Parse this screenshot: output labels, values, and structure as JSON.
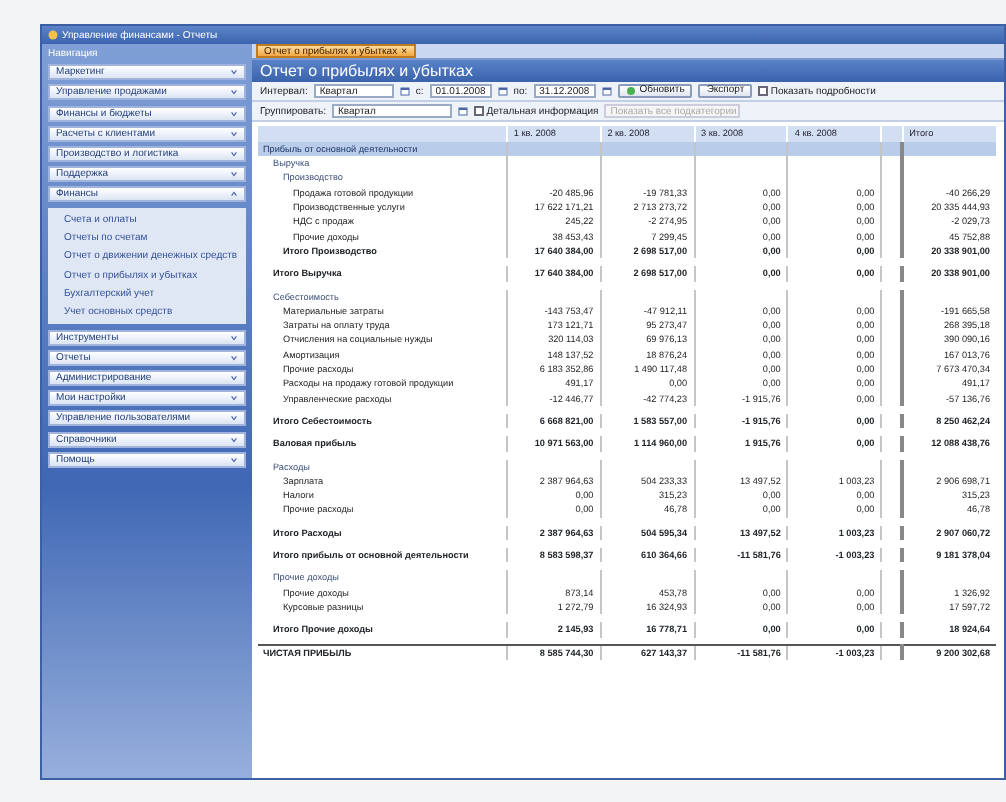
{
  "window": {
    "title": "Управление финансами - Отчеты"
  },
  "sidebar": {
    "title": "Навигация",
    "groups": [
      {
        "label": "Маркетинг",
        "expanded": false
      },
      {
        "label": "Управление продажами",
        "expanded": false
      },
      {
        "label": "Финансы и бюджеты",
        "expanded": false
      },
      {
        "label": "Расчеты с клиентами",
        "expanded": false
      },
      {
        "label": "Производство и логистика",
        "expanded": false
      },
      {
        "label": "Поддержка",
        "expanded": false
      },
      {
        "label": "Финансы",
        "expanded": true,
        "items": [
          "Счета и оплаты",
          "Отчеты по счетам",
          "Отчет о движении денежных средств",
          "Отчет о прибылях и убытках",
          "Бухгалтерский учет",
          "Учет основных средств"
        ]
      },
      {
        "label": "Инструменты",
        "expanded": false
      },
      {
        "label": "Отчеты",
        "expanded": false
      },
      {
        "label": "Администрирование",
        "expanded": false
      },
      {
        "label": "Мои настройки",
        "expanded": false
      },
      {
        "label": "Управление пользователями",
        "expanded": false
      },
      {
        "label": "Справочники",
        "expanded": false
      },
      {
        "label": "Помощь",
        "expanded": false
      }
    ]
  },
  "tabs": [
    {
      "label": "Отчет о прибылях и убытках",
      "selected": true,
      "close": "×"
    }
  ],
  "report": {
    "title": "Отчет о прибылях и убытках",
    "toolbar": {
      "interval_label": "Интервал:",
      "interval": "Квартал",
      "from_label": "с:",
      "from": "01.01.2008",
      "to_label": "по:",
      "to": "31.12.2008",
      "refresh": "Обновить",
      "export": "Экспорт",
      "details": {
        "label": "Показать подробности",
        "checked": false
      }
    },
    "toolbar2": {
      "group_label": "Группировать:",
      "group": "Квартал",
      "detail": {
        "label": "Детальная информация",
        "checked": false
      },
      "filter": {
        "placeholder": "Показать все подкатегории",
        "disabled": true
      }
    },
    "columns": [
      "1 кв. 2008",
      "2 кв. 2008",
      "3 кв. 2008",
      "4 кв. 2008",
      "Итого"
    ],
    "rows": [
      {
        "kind": "section",
        "label": "Прибыль от основной деятельности",
        "children": [
          {
            "kind": "group",
            "label": "Выручка",
            "children": [
              {
                "kind": "group",
                "label": "Производство",
                "children": [
                  {
                    "kind": "item",
                    "label": "Продажа готовой продукции",
                    "values": [
                      "-20 485,96",
                      "-19 781,33",
                      "0,00",
                      "0,00",
                      "-40 266,29"
                    ]
                  },
                  {
                    "kind": "item",
                    "label": "Производственные услуги",
                    "values": [
                      "17 622 171,21",
                      "2 713 273,72",
                      "0,00",
                      "0,00",
                      "20 335 444,93"
                    ]
                  },
                  {
                    "kind": "item",
                    "label": "НДС с продаж",
                    "values": [
                      "245,22",
                      "-2 274,95",
                      "0,00",
                      "0,00",
                      "-2 029,73"
                    ]
                  },
                  {
                    "kind": "item",
                    "label": "Прочие доходы",
                    "values": [
                      "38 453,43",
                      "7 299,45",
                      "0,00",
                      "0,00",
                      "45 752,88"
                    ]
                  }
                ]
              },
              {
                "kind": "total",
                "label": "Итого Производство",
                "values": [
                  "17 640 384,00",
                  "2 698 517,00",
                  "0,00",
                  "0,00",
                  "20 338 901,00"
                ]
              }
            ]
          },
          {
            "kind": "total",
            "label": "Итого Выручка",
            "values": [
              "17 640 384,00",
              "2 698 517,00",
              "0,00",
              "0,00",
              "20 338 901,00"
            ]
          },
          {
            "kind": "group",
            "label": "Себестоимость",
            "children": [
              {
                "kind": "item",
                "label": "Материальные затраты",
                "values": [
                  "-143 753,47",
                  "-47 912,11",
                  "0,00",
                  "0,00",
                  "-191 665,58"
                ]
              },
              {
                "kind": "item",
                "label": "Затраты на оплату труда",
                "values": [
                  "173 121,71",
                  "95 273,47",
                  "0,00",
                  "0,00",
                  "268 395,18"
                ]
              },
              {
                "kind": "item",
                "label": "Отчисления на социальные нужды",
                "values": [
                  "320 114,03",
                  "69 976,13",
                  "0,00",
                  "0,00",
                  "390 090,16"
                ]
              },
              {
                "kind": "item",
                "label": "Амортизация",
                "values": [
                  "148 137,52",
                  "18 876,24",
                  "0,00",
                  "0,00",
                  "167 013,76"
                ]
              },
              {
                "kind": "item",
                "label": "Прочие расходы",
                "values": [
                  "6 183 352,86",
                  "1 490 117,48",
                  "0,00",
                  "0,00",
                  "7 673 470,34"
                ]
              },
              {
                "kind": "item",
                "label": "Расходы на продажу готовой продукции",
                "values": [
                  "491,17",
                  "0,00",
                  "0,00",
                  "0,00",
                  "491,17"
                ]
              },
              {
                "kind": "item",
                "label": "Управленческие расходы",
                "values": [
                  "-12 446,77",
                  "-42 774,23",
                  "-1 915,76",
                  "0,00",
                  "-57 136,76"
                ]
              }
            ]
          },
          {
            "kind": "total",
            "label": "Итого Себестоимость",
            "values": [
              "6 668 821,00",
              "1 583 557,00",
              "-1 915,76",
              "0,00",
              "8 250 462,24"
            ]
          },
          {
            "kind": "total",
            "label": "Валовая прибыль",
            "values": [
              "10 971 563,00",
              "1 114 960,00",
              "1 915,76",
              "0,00",
              "12 088 438,76"
            ]
          },
          {
            "kind": "group",
            "label": "Расходы",
            "children": [
              {
                "kind": "item",
                "label": "Зарплата",
                "values": [
                  "2 387 964,63",
                  "504 233,33",
                  "13 497,52",
                  "1 003,23",
                  "2 906 698,71"
                ]
              },
              {
                "kind": "item",
                "label": "Налоги",
                "values": [
                  "0,00",
                  "315,23",
                  "0,00",
                  "0,00",
                  "315,23"
                ]
              },
              {
                "kind": "item",
                "label": "Прочие расходы",
                "values": [
                  "0,00",
                  "46,78",
                  "0,00",
                  "0,00",
                  "46,78"
                ]
              }
            ]
          },
          {
            "kind": "total",
            "label": "Итого Расходы",
            "values": [
              "2 387 964,63",
              "504 595,34",
              "13 497,52",
              "1 003,23",
              "2 907 060,72"
            ]
          },
          {
            "kind": "total",
            "label": "Итого прибыль от основной деятельности",
            "values": [
              "8 583 598,37",
              "610 364,66",
              "-11 581,76",
              "-1 003,23",
              "9 181 378,04"
            ]
          },
          {
            "kind": "group",
            "label": "Прочие доходы",
            "children": [
              {
                "kind": "item",
                "label": "Прочие доходы",
                "values": [
                  "873,14",
                  "453,78",
                  "0,00",
                  "0,00",
                  "1 326,92"
                ]
              },
              {
                "kind": "item",
                "label": "Курсовые разницы",
                "values": [
                  "1 272,79",
                  "16 324,93",
                  "0,00",
                  "0,00",
                  "17 597,72"
                ]
              }
            ]
          },
          {
            "kind": "total",
            "label": "Итого Прочие доходы",
            "values": [
              "2 145,93",
              "16 778,71",
              "0,00",
              "0,00",
              "18 924,64"
            ]
          }
        ]
      },
      {
        "kind": "grand",
        "label": "ЧИСТАЯ ПРИБЫЛЬ",
        "values": [
          "8 585 744,30",
          "627 143,37",
          "-11 581,76",
          "-1 003,23",
          "9 200 302,68"
        ]
      }
    ]
  }
}
